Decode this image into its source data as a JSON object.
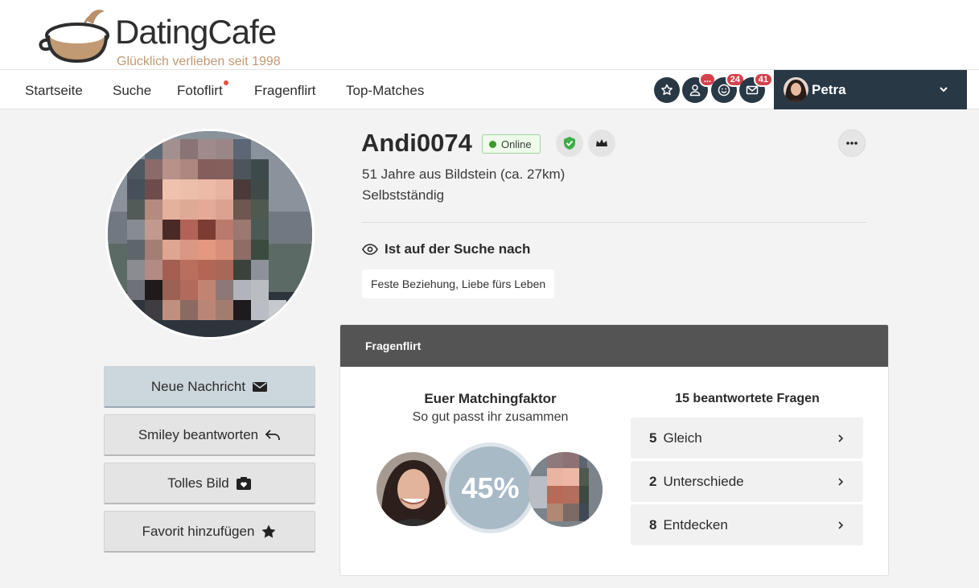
{
  "brand": {
    "name": "DatingCafe",
    "tagline": "Glücklich verlieben seit 1998",
    "accent": "#c19a73"
  },
  "nav": {
    "items": [
      {
        "label": "Startseite"
      },
      {
        "label": "Suche"
      },
      {
        "label": "Fotoflirt",
        "has_dot": true
      },
      {
        "label": "Fragenflirt"
      },
      {
        "label": "Top-Matches"
      }
    ],
    "icons": [
      {
        "icon": "star-icon"
      },
      {
        "icon": "person-icon",
        "badge": "..."
      },
      {
        "icon": "smiley-icon",
        "badge": "24"
      },
      {
        "icon": "mail-icon",
        "badge": "41"
      }
    ],
    "user": {
      "name": "Petra"
    }
  },
  "profile": {
    "username": "Andi0074",
    "status": "Online",
    "age_location": "51 Jahre aus Bildstein (ca. 27km)",
    "occupation": "Selbstständig",
    "seeking_label": "Ist auf der Suche nach",
    "seeking_value": "Feste Beziehung, Liebe fürs Leben"
  },
  "actions": {
    "message": "Neue Nachricht",
    "smiley": "Smiley beantworten",
    "photo": "Tolles Bild",
    "favorite": "Favorit hinzufügen"
  },
  "fragenflirt": {
    "header": "Fragenflirt",
    "match_title": "Euer Matchingfaktor",
    "match_subtitle": "So gut passt ihr zusammen",
    "match_percent": "45%",
    "answered_label": "15 beantwortete Fragen",
    "rows": [
      {
        "count": "5",
        "label": "Gleich"
      },
      {
        "count": "2",
        "label": "Unterschiede"
      },
      {
        "count": "8",
        "label": "Entdecken"
      }
    ]
  }
}
